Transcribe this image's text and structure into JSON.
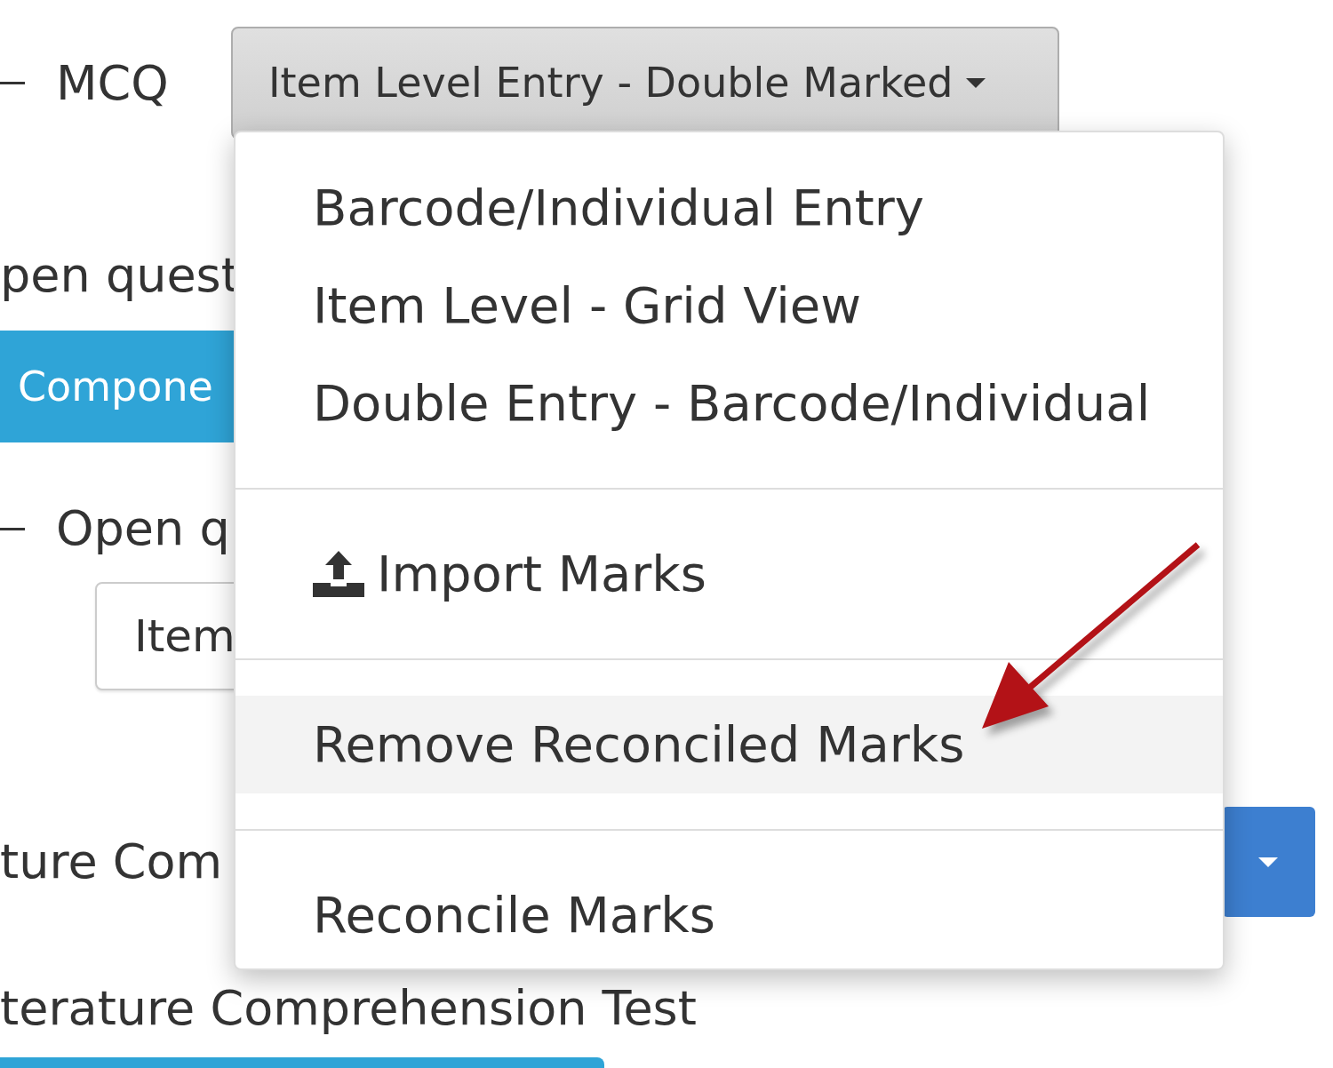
{
  "rows": [
    {
      "kind": "branch",
      "label": "MCQ"
    },
    {
      "kind": "text",
      "label": "pen quest"
    },
    {
      "kind": "primary-button",
      "label": "Compone"
    },
    {
      "kind": "branch",
      "label": "Open q"
    },
    {
      "kind": "default-button",
      "label": "Item"
    },
    {
      "kind": "text-with-button",
      "label": "ture Com"
    },
    {
      "kind": "text",
      "label": "terature Comprehension Test"
    },
    {
      "kind": "bar-button"
    }
  ],
  "dropdown": {
    "toggle": "Item Level Entry - Double Marked",
    "groups": [
      [
        {
          "kind": "text-item",
          "label": "Barcode/Individual Entry",
          "highlighted": false
        },
        {
          "kind": "text-item",
          "label": "Item Level - Grid View",
          "highlighted": false
        },
        {
          "kind": "text-item",
          "label": "Double Entry - Barcode/Individual",
          "highlighted": false
        }
      ],
      [
        {
          "kind": "icon-item",
          "label": "Import Marks",
          "highlighted": false
        }
      ],
      [
        {
          "kind": "text-item",
          "label": "Remove Reconciled Marks",
          "highlighted": true
        }
      ],
      [
        {
          "kind": "text-item",
          "label": "Reconcile Marks",
          "highlighted": false
        }
      ]
    ]
  }
}
